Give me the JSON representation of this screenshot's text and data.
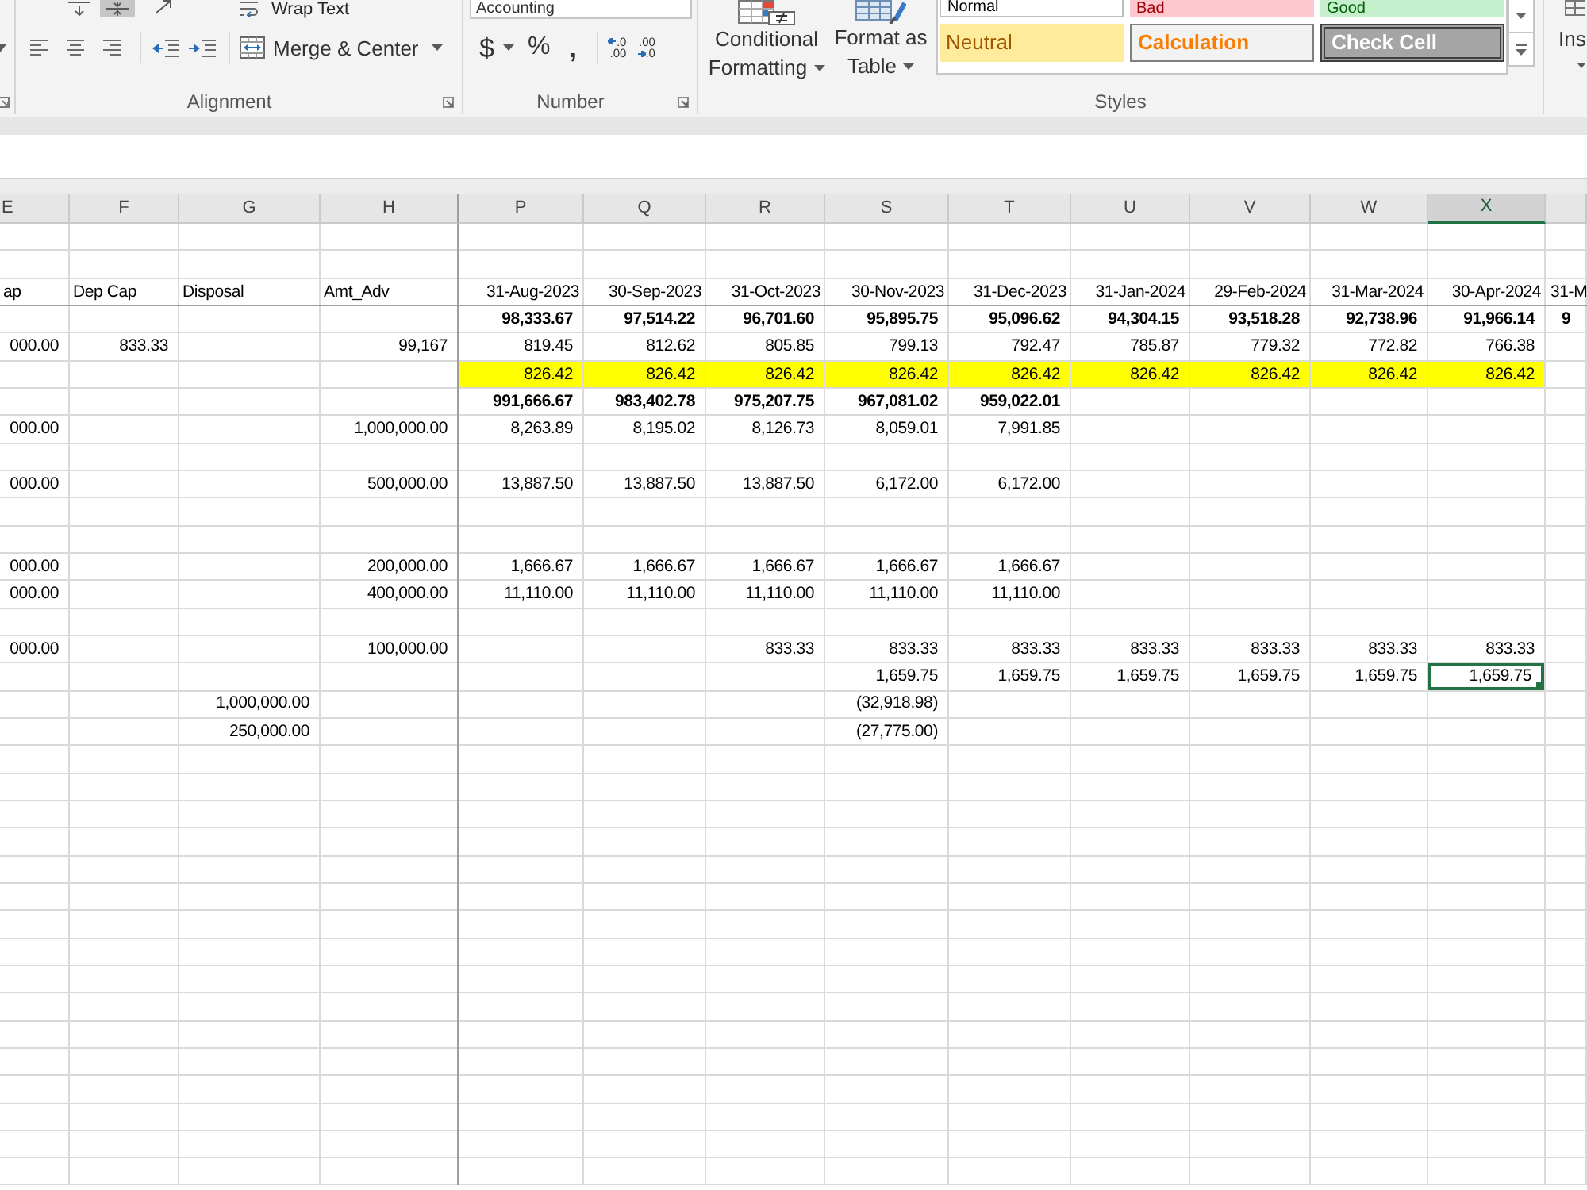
{
  "ribbon": {
    "alignment": {
      "vertical_align": [
        {
          "kind": "top",
          "selected": false
        },
        {
          "kind": "middle",
          "selected": true
        }
      ],
      "wrap_text": "Wrap Text",
      "horizontal_align": [
        {
          "kind": "left",
          "selected": false
        },
        {
          "kind": "center",
          "selected": false
        },
        {
          "kind": "right",
          "selected": false
        }
      ],
      "merge_center": "Merge & Center",
      "label": "Alignment"
    },
    "number": {
      "format": "Accounting",
      "currency": "$",
      "percent": "%",
      "comma": ",",
      "increase_decimal": [
        ".0",
        ".00"
      ],
      "decrease_decimal": [
        ".00",
        ".0"
      ],
      "label": "Number"
    },
    "styles": {
      "conditional_formatting": [
        "Conditional",
        "Formatting"
      ],
      "format_as_table": [
        "Format as",
        "Table"
      ],
      "cell_styles": [
        {
          "label": "Normal",
          "kind": "normal"
        },
        {
          "label": "Bad",
          "kind": "bad"
        },
        {
          "label": "Good",
          "kind": "good"
        },
        {
          "label": "Neutral",
          "kind": "neutral"
        },
        {
          "label": "Calculation",
          "kind": "calculation"
        },
        {
          "label": "Check Cell",
          "kind": "check"
        }
      ],
      "label": "Styles"
    },
    "cells": {
      "insert": "Ins"
    }
  },
  "sheet": {
    "columns": [
      {
        "label": "E",
        "selected": false
      },
      {
        "label": "F",
        "selected": false
      },
      {
        "label": "G",
        "selected": false
      },
      {
        "label": "H",
        "selected": false,
        "frozen": true
      },
      {
        "label": "P",
        "selected": false
      },
      {
        "label": "Q",
        "selected": false
      },
      {
        "label": "R",
        "selected": false
      },
      {
        "label": "S",
        "selected": false
      },
      {
        "label": "T",
        "selected": false
      },
      {
        "label": "U",
        "selected": false
      },
      {
        "label": "V",
        "selected": false
      },
      {
        "label": "W",
        "selected": false
      },
      {
        "label": "X",
        "selected": true
      },
      {
        "selected": false
      }
    ],
    "rows": [
      {
        "selected": false
      },
      {
        "selected": false
      },
      {
        "selected": false,
        "frozen": true,
        "cells": [
          {
            "text": "ap",
            "kind": "text"
          },
          {
            "text": "Dep Cap",
            "kind": "text"
          },
          {
            "text": "Disposal",
            "kind": "text"
          },
          {
            "text": "Amt_Adv",
            "kind": "text"
          },
          {
            "text": "31-Aug-2023",
            "kind": "date"
          },
          {
            "text": "30-Sep-2023",
            "kind": "date"
          },
          {
            "text": "31-Oct-2023",
            "kind": "date"
          },
          {
            "text": "30-Nov-2023",
            "kind": "date"
          },
          {
            "text": "31-Dec-2023",
            "kind": "date"
          },
          {
            "text": "31-Jan-2024",
            "kind": "date"
          },
          {
            "text": "29-Feb-2024",
            "kind": "date"
          },
          {
            "text": "31-Mar-2024",
            "kind": "date"
          },
          {
            "text": "30-Apr-2024",
            "kind": "date"
          },
          {
            "text": "31-M",
            "kind": "date"
          }
        ]
      },
      {
        "selected": false,
        "bold": true,
        "cells": [
          null,
          null,
          null,
          null,
          "98,333.67",
          "97,514.22",
          "96,701.60",
          "95,895.75",
          "95,096.62",
          "94,304.15",
          "93,518.28",
          "92,738.96",
          "91,966.14",
          "9"
        ]
      },
      {
        "selected": false,
        "cells": [
          "000.00",
          "833.33",
          null,
          "99,167",
          "819.45",
          "812.62",
          "805.85",
          "799.13",
          "792.47",
          "785.87",
          "779.32",
          "772.82",
          "766.38"
        ]
      },
      {
        "selected": false,
        "highlighted": true,
        "cells": [
          null,
          null,
          null,
          null,
          "826.42",
          "826.42",
          "826.42",
          "826.42",
          "826.42",
          "826.42",
          "826.42",
          "826.42",
          "826.42"
        ]
      },
      {
        "selected": false,
        "bold": true,
        "cells": [
          null,
          null,
          null,
          null,
          "991,666.67",
          "983,402.78",
          "975,207.75",
          "967,081.02",
          "959,022.01"
        ]
      },
      {
        "selected": false,
        "cells": [
          "000.00",
          null,
          null,
          "1,000,000.00",
          "8,263.89",
          "8,195.02",
          "8,126.73",
          "8,059.01",
          "7,991.85"
        ]
      },
      {
        "selected": false
      },
      {
        "selected": false,
        "cells": [
          "000.00",
          null,
          null,
          "500,000.00",
          "13,887.50",
          "13,887.50",
          "13,887.50",
          "6,172.00",
          "6,172.00"
        ]
      },
      {
        "selected": false
      },
      {
        "selected": false
      },
      {
        "selected": false,
        "cells": [
          "000.00",
          null,
          null,
          "200,000.00",
          "1,666.67",
          "1,666.67",
          "1,666.67",
          "1,666.67",
          "1,666.67"
        ]
      },
      {
        "selected": false,
        "cells": [
          "000.00",
          null,
          null,
          "400,000.00",
          "11,110.00",
          "11,110.00",
          "11,110.00",
          "11,110.00",
          "11,110.00"
        ]
      },
      {
        "selected": false
      },
      {
        "selected": false,
        "cells": [
          "000.00",
          null,
          null,
          "100,000.00",
          null,
          null,
          "833.33",
          "833.33",
          "833.33",
          "833.33",
          "833.33",
          "833.33",
          "833.33"
        ]
      },
      {
        "selected": true,
        "cells": [
          null,
          null,
          null,
          null,
          null,
          null,
          null,
          "1,659.75",
          "1,659.75",
          "1,659.75",
          "1,659.75",
          "1,659.75",
          "1,659.75"
        ]
      },
      {
        "selected": false,
        "cells": [
          null,
          null,
          "1,000,000.00",
          null,
          null,
          null,
          null,
          "(32,918.98)"
        ]
      },
      {
        "selected": false,
        "cells": [
          null,
          null,
          "250,000.00",
          null,
          null,
          null,
          null,
          "(27,775.00)"
        ]
      },
      {
        "selected": false
      },
      {
        "selected": false
      },
      {
        "selected": false
      },
      {
        "selected": false
      },
      {
        "selected": false
      },
      {
        "selected": false
      },
      {
        "selected": false
      },
      {
        "selected": false
      },
      {
        "selected": false
      },
      {
        "selected": false
      },
      {
        "selected": false
      },
      {
        "selected": false
      },
      {
        "selected": false
      },
      {
        "selected": false
      },
      {
        "selected": false
      },
      {
        "selected": false
      }
    ]
  }
}
